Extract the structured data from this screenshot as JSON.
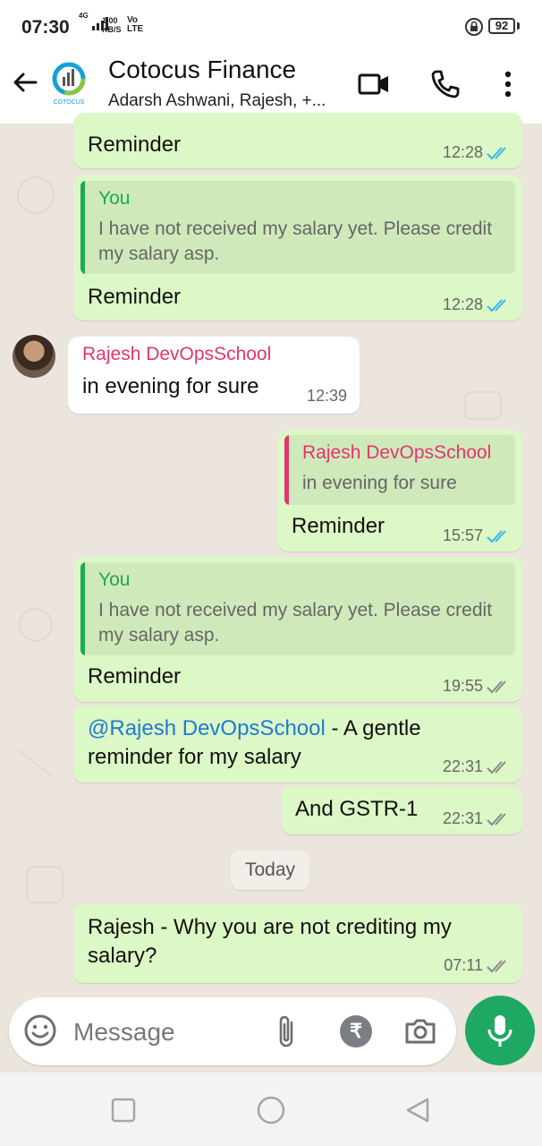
{
  "status": {
    "time": "07:30",
    "net": "4G",
    "speed_value": "1.00",
    "speed_unit": "KB/S",
    "volte_top": "Vo",
    "volte_bottom": "LTE",
    "battery": "92"
  },
  "header": {
    "title": "Cotocus Finance",
    "subtitle": "Adarsh Ashwani, Rajesh, +...",
    "logo_text": "COTOCUS"
  },
  "messages": {
    "m1": {
      "text": "Reminder",
      "time": "12:28"
    },
    "m2": {
      "quote_name": "You",
      "quote_text": "I have not received my salary yet. Please credit my salary asp.",
      "text": "Reminder",
      "time": "12:28"
    },
    "m3": {
      "sender": "Rajesh DevOpsSchool",
      "text": "in evening for sure",
      "time": "12:39"
    },
    "m4": {
      "quote_name": "Rajesh DevOpsSchool",
      "quote_text": "in evening for sure",
      "text": "Reminder",
      "time": "15:57"
    },
    "m5": {
      "quote_name": "You",
      "quote_text": "I have not received my salary yet. Please credit my salary asp.",
      "text": "Reminder",
      "time": "19:55"
    },
    "m6": {
      "mention": "@Rajesh DevOpsSchool",
      "text_after_mention": " - A gentle",
      "line2": "reminder for my salary",
      "time": "22:31"
    },
    "m7": {
      "text": "And GSTR-1",
      "time": "22:31"
    },
    "date_chip": "Today",
    "m8": {
      "line1": "Rajesh - Why you are not crediting my",
      "line2": "salary?",
      "time": "07:11"
    }
  },
  "input": {
    "placeholder": "Message",
    "rupee_symbol": "₹"
  },
  "colors": {
    "outgoing": "#dcf8c6",
    "incoming": "#ffffff",
    "accent": "#1ea862",
    "read_ticks": "#34b7f1",
    "sent_ticks": "#8a8a8a",
    "mention": "#1f7ad1",
    "sender_name": "#e3356f",
    "quote_you": "#1fa855"
  },
  "icons": [
    "back-arrow-icon",
    "video-call-icon",
    "phone-icon",
    "more-vert-icon",
    "emoji-icon",
    "attach-icon",
    "rupee-icon",
    "camera-icon",
    "mic-icon",
    "nav-recent-icon",
    "nav-home-icon",
    "nav-back-icon",
    "lock-icon"
  ]
}
